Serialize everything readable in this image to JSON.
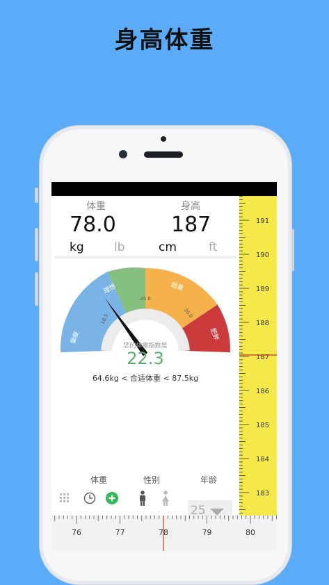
{
  "page_title": "身高体重",
  "weight": {
    "label": "体重",
    "value": "78.0",
    "unit_kg": "kg",
    "unit_lb": "lb"
  },
  "height": {
    "label": "身高",
    "value": "187",
    "unit_cm": "cm",
    "unit_ft": "ft"
  },
  "gauge": {
    "caption": "您的体重指数是",
    "bmi": "22.3",
    "bmi_value": 22.3,
    "zones": [
      "偏瘦",
      "理想",
      "超重",
      "肥胖"
    ],
    "thresholds": [
      "18.5",
      "25.0",
      "30.0"
    ],
    "colors": {
      "thin": "#7ab3e6",
      "ideal": "#86c07f",
      "over": "#f6b24a",
      "obese": "#cc3b3b",
      "bmi_text": "#5aae6a"
    }
  },
  "range_text": "64.6kg < 合适体重 < 87.5kg",
  "controls": {
    "weight": "体重",
    "gender": "性别",
    "age": "年龄",
    "age_value": "25"
  },
  "height_ruler": {
    "labels": [
      "191",
      "190",
      "189",
      "188",
      "187",
      "186",
      "185",
      "184",
      "183"
    ]
  },
  "weight_ruler": {
    "labels": [
      "76",
      "77",
      "78",
      "79",
      "80"
    ]
  }
}
